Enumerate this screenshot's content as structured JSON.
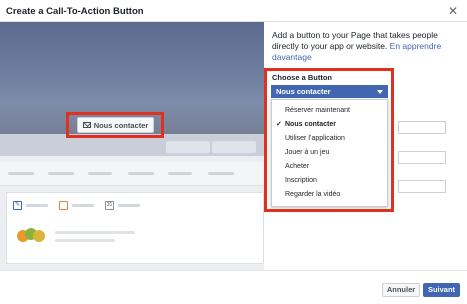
{
  "dialog": {
    "title": "Create a Call-To-Action Button",
    "close_icon": "close-icon"
  },
  "preview": {
    "cta_label": "Nous contacter",
    "cta_icon": "envelope-icon"
  },
  "panel": {
    "description": "Add a button to your Page that takes people directly to your app or website.",
    "learn_more": "En apprendre davantage",
    "choose_label": "Choose a Button",
    "selected": "Nous contacter",
    "options": [
      "Réserver maintenant",
      "Nous contacter",
      "Utiliser l’application",
      "Jouer à un jeu",
      "Acheter",
      "Inscription",
      "Regarder la vidéo"
    ]
  },
  "footer": {
    "cancel": "Annuler",
    "next": "Suivant"
  },
  "colors": {
    "accent": "#4267b2",
    "highlight": "#e0301e"
  }
}
